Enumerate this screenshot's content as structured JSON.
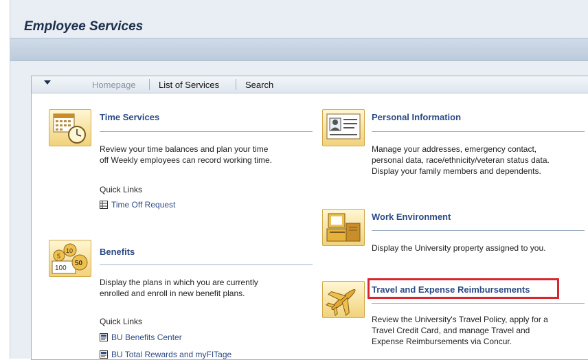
{
  "page": {
    "title": "Employee Services"
  },
  "nav": {
    "homepage": "Homepage",
    "list_of_services": "List of Services",
    "search": "Search"
  },
  "services": {
    "time": {
      "title": "Time Services",
      "desc_1": "Review your time balances and plan your time",
      "desc_2": "off  Weekly employees can record working time.",
      "quick_links_label": "Quick Links",
      "link_1": "Time Off Request"
    },
    "benefits": {
      "title": "Benefits",
      "desc_1": "Display the plans in which you are currently",
      "desc_2": "enrolled and enroll in new benefit plans.",
      "quick_links_label": "Quick Links",
      "link_1": "BU Benefits Center",
      "link_2": "BU Total Rewards and myFITage"
    },
    "personal": {
      "title": "Personal Information",
      "desc_1": "Manage your addresses, emergency contact,",
      "desc_2": "personal data, race/ethnicity/veteran status data.",
      "desc_3": "Display your family members and dependents."
    },
    "work": {
      "title": "Work Environment",
      "desc_1": "Display the University property assigned to you."
    },
    "travel": {
      "title": "Travel and Expense Reimbursements",
      "desc_1": "Review the University's Travel Policy, apply for a",
      "desc_2": "Travel Credit Card, and manage Travel and",
      "desc_3": "Expense Reimbursements via Concur."
    }
  },
  "colors": {
    "link": "#2b4a84",
    "highlight": "#d8262f",
    "tile": "#f1d27b"
  }
}
